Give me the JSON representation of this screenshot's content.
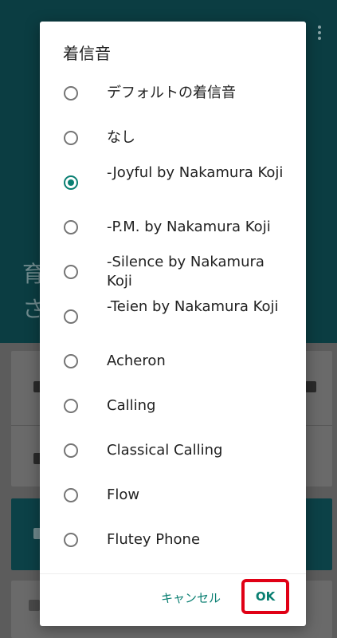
{
  "background": {
    "heading_line1": "育",
    "heading_line2": "さ"
  },
  "dialog": {
    "title": "着信音",
    "options": [
      {
        "label": "デフォルトの着信音",
        "checked": false
      },
      {
        "label": "なし",
        "checked": false
      },
      {
        "label": "-Joyful by Nakamura Koji",
        "checked": true
      },
      {
        "label": "-P.M. by Nakamura Koji",
        "checked": false
      },
      {
        "label": "-Silence by Nakamura Koji",
        "checked": false
      },
      {
        "label": "-Teien by Nakamura Koji",
        "checked": false
      },
      {
        "label": "Acheron",
        "checked": false
      },
      {
        "label": "Calling",
        "checked": false
      },
      {
        "label": "Classical Calling",
        "checked": false
      },
      {
        "label": "Flow",
        "checked": false
      },
      {
        "label": "Flutey Phone",
        "checked": false
      }
    ],
    "cancel_label": "キャンセル",
    "ok_label": "OK"
  },
  "colors": {
    "accent": "#0a7f72",
    "highlight": "#e00015",
    "app_bar": "#0b3d42"
  }
}
